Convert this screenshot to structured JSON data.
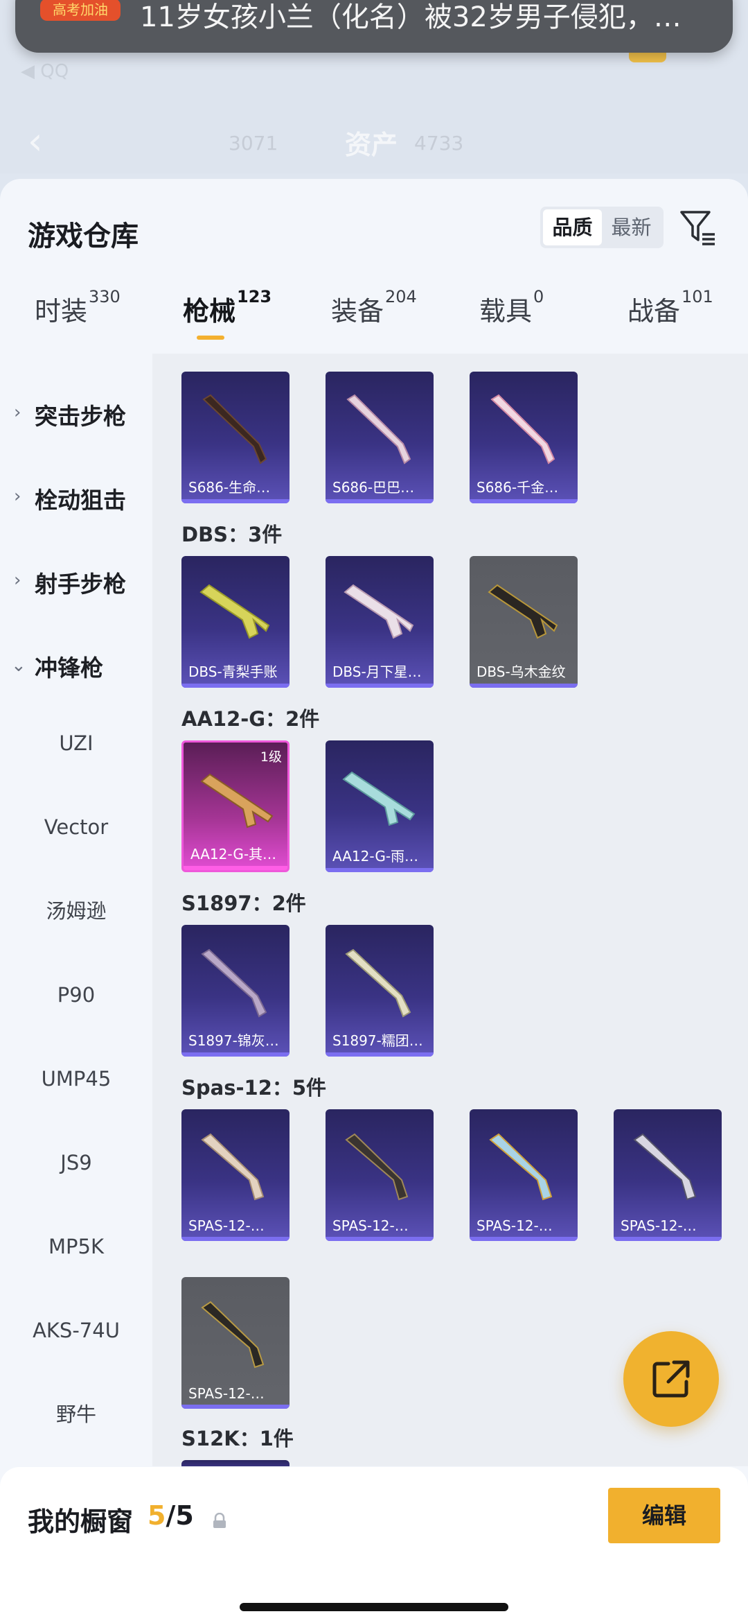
{
  "background": {
    "back_source": "◀ QQ",
    "dim_left": "3071",
    "title": "资产",
    "dim_right": "4733"
  },
  "notification": {
    "app_label": "高考加油",
    "text": "11岁女孩小兰（化名）被32岁男子侵犯，…"
  },
  "sheet": {
    "title": "游戏仓库",
    "sort": {
      "selected": "品质",
      "other": "最新"
    },
    "filter_icon": "filter-list-icon"
  },
  "tabs": [
    {
      "label": "时装",
      "count": "330"
    },
    {
      "label": "枪械",
      "count": "123"
    },
    {
      "label": "装备",
      "count": "204"
    },
    {
      "label": "载具",
      "count": "0"
    },
    {
      "label": "战备",
      "count": "101"
    }
  ],
  "active_tab": "枪械",
  "sidebar": {
    "categories": [
      {
        "label": "突击步枪",
        "expanded": false
      },
      {
        "label": "栓动狙击",
        "expanded": false
      },
      {
        "label": "射手步枪",
        "expanded": false
      },
      {
        "label": "冲锋枪",
        "expanded": true
      }
    ],
    "subitems": [
      "UZI",
      "Vector",
      "汤姆逊",
      "P90",
      "UMP45",
      "JS9",
      "MP5K",
      "AKS-74U",
      "野牛"
    ]
  },
  "groups": [
    {
      "title": "",
      "items": [
        {
          "name": "S686-生命…",
          "rarity": "purple"
        },
        {
          "name": "S686-巴巴…",
          "rarity": "purple"
        },
        {
          "name": "S686-千金…",
          "rarity": "purple"
        }
      ]
    },
    {
      "title": "DBS：3件",
      "items": [
        {
          "name": "DBS-青梨手账",
          "rarity": "purple"
        },
        {
          "name": "DBS-月下星…",
          "rarity": "purple"
        },
        {
          "name": "DBS-乌木金纹",
          "rarity": "gray"
        }
      ]
    },
    {
      "title": "AA12-G：2件",
      "items": [
        {
          "name": "AA12-G-其…",
          "rarity": "pink",
          "level": "1级"
        },
        {
          "name": "AA12-G-雨…",
          "rarity": "purple"
        }
      ]
    },
    {
      "title": "S1897：2件",
      "items": [
        {
          "name": "S1897-锦灰…",
          "rarity": "purple"
        },
        {
          "name": "S1897-糯团…",
          "rarity": "purple"
        }
      ]
    },
    {
      "title": "Spas-12：5件",
      "items": [
        {
          "name": "SPAS-12-…",
          "rarity": "purple"
        },
        {
          "name": "SPAS-12-…",
          "rarity": "purple"
        },
        {
          "name": "SPAS-12-…",
          "rarity": "purple"
        },
        {
          "name": "SPAS-12-…",
          "rarity": "purple"
        },
        {
          "name": "SPAS-12-…",
          "rarity": "gray"
        }
      ]
    },
    {
      "title": "S12K：1件",
      "items": []
    }
  ],
  "fab_icon": "share-external-icon",
  "showcase": {
    "title": "我的橱窗",
    "current": "5",
    "total": "/5",
    "edit_label": "编辑"
  }
}
